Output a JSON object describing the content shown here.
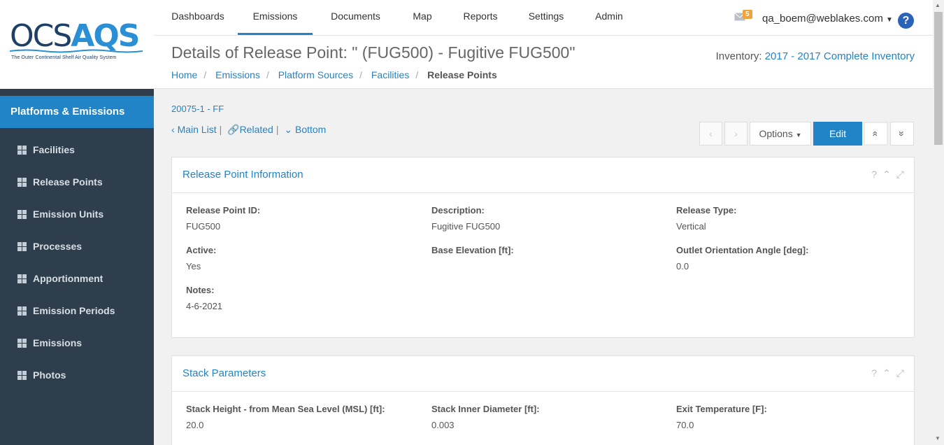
{
  "logo": {
    "main": "OCS",
    "accent": "AQS",
    "subtitle": "The Outer Continental Shelf Air Quality System"
  },
  "sidebar": {
    "heading": "Platforms & Emissions",
    "items": [
      {
        "label": "Facilities"
      },
      {
        "label": "Release Points"
      },
      {
        "label": "Emission Units"
      },
      {
        "label": "Processes"
      },
      {
        "label": "Apportionment"
      },
      {
        "label": "Emission Periods"
      },
      {
        "label": "Emissions"
      },
      {
        "label": "Photos"
      }
    ]
  },
  "topnav": {
    "items": [
      {
        "label": "Dashboards"
      },
      {
        "label": "Emissions"
      },
      {
        "label": "Documents"
      },
      {
        "label": "Map"
      },
      {
        "label": "Reports"
      },
      {
        "label": "Settings"
      },
      {
        "label": "Admin"
      }
    ],
    "active": "Emissions",
    "mail_count": "5",
    "user": "qa_boem@weblakes.com",
    "help": "?"
  },
  "header": {
    "title": "Details of Release Point: \" (FUG500) - Fugitive FUG500\"",
    "inventory_label": "Inventory:",
    "inventory_value": "2017 - 2017 Complete Inventory",
    "breadcrumb": [
      "Home",
      "Emissions",
      "Platform Sources",
      "Facilities",
      "Release Points"
    ]
  },
  "record": {
    "id": "20075-1 - FF",
    "links": {
      "main_list": "Main List",
      "related": "Related",
      "bottom": "Bottom"
    }
  },
  "toolbar": {
    "prev": "‹",
    "next": "›",
    "options": "Options",
    "edit": "Edit",
    "top": "«",
    "bottom": "»"
  },
  "panels": {
    "info": {
      "title": "Release Point Information",
      "fields": {
        "release_point_id": {
          "label": "Release Point ID:",
          "value": "FUG500"
        },
        "description": {
          "label": "Description:",
          "value": "Fugitive FUG500"
        },
        "release_type": {
          "label": "Release Type:",
          "value": "Vertical"
        },
        "active": {
          "label": "Active:",
          "value": "Yes"
        },
        "base_elevation": {
          "label": "Base Elevation [ft]:",
          "value": ""
        },
        "outlet_angle": {
          "label": "Outlet Orientation Angle [deg]:",
          "value": "0.0"
        },
        "notes": {
          "label": "Notes:",
          "value": "4-6-2021"
        }
      }
    },
    "stack": {
      "title": "Stack Parameters",
      "fields": {
        "stack_height": {
          "label": "Stack Height - from Mean Sea Level (MSL) [ft]:",
          "value": "20.0"
        },
        "inner_diameter": {
          "label": "Stack Inner Diameter [ft]:",
          "value": "0.003"
        },
        "exit_temperature": {
          "label": "Exit Temperature [F]:",
          "value": "70.0"
        }
      }
    }
  },
  "colors": {
    "accent": "#2184c7",
    "sidebar_bg": "#2f3e4c",
    "badge": "#f0a23b"
  }
}
